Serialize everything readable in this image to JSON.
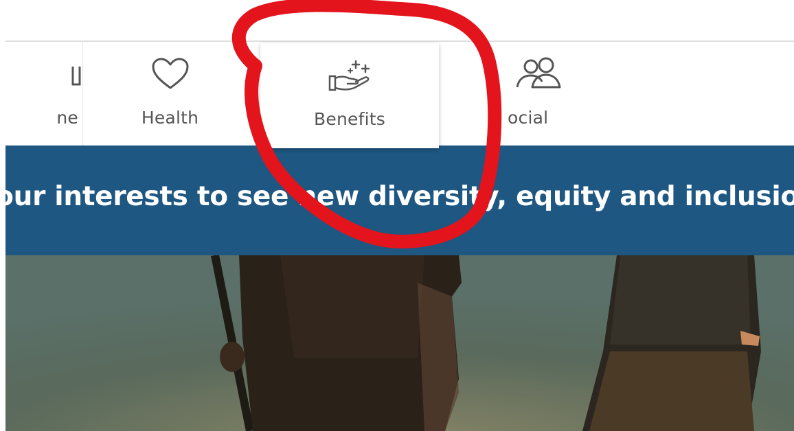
{
  "nav": {
    "tabs": [
      {
        "id": "home",
        "label": "ne",
        "icon": "home-icon"
      },
      {
        "id": "health",
        "label": "Health",
        "icon": "heart-icon"
      },
      {
        "id": "benefits",
        "label": "Benefits",
        "icon": "hand-sparkles-icon",
        "selected": true
      },
      {
        "id": "social",
        "label": "ocial",
        "icon": "people-icon"
      }
    ]
  },
  "banner": {
    "text": "your interests to see new diversity, equity and inclusio",
    "background": "#1e5782",
    "text_color": "#ffffff"
  },
  "hero_image": {
    "description_icon": "photo-people-silhouettes"
  },
  "annotation": {
    "color": "#e3141b",
    "shape": "hand-drawn-circle"
  }
}
